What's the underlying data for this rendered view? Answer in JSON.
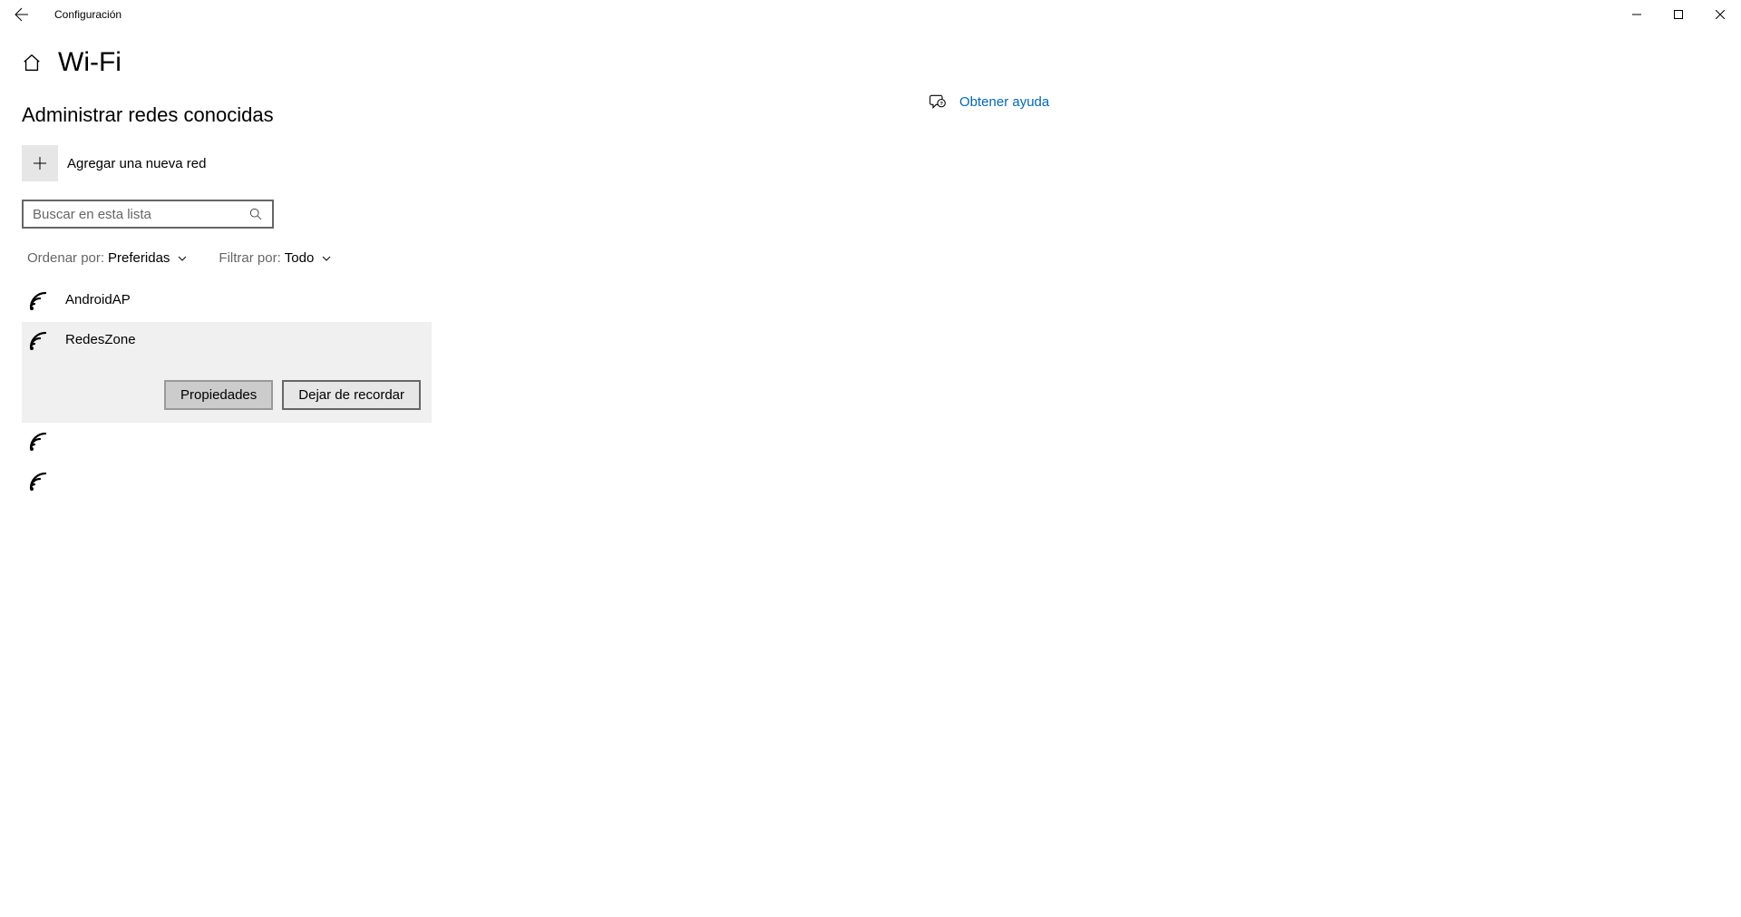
{
  "titlebar": {
    "app_title": "Configuración"
  },
  "page": {
    "title": "Wi-Fi",
    "section_title": "Administrar redes conocidas",
    "add_network_label": "Agregar una nueva red"
  },
  "search": {
    "placeholder": "Buscar en esta lista"
  },
  "sort": {
    "label": "Ordenar por: ",
    "value": "Preferidas"
  },
  "filter": {
    "label": "Filtrar por: ",
    "value": "Todo"
  },
  "networks": [
    {
      "name": "AndroidAP"
    },
    {
      "name": "RedesZone"
    },
    {
      "name": ""
    },
    {
      "name": ""
    }
  ],
  "actions": {
    "properties": "Propiedades",
    "forget": "Dejar de recordar"
  },
  "help": {
    "link_text": "Obtener ayuda"
  }
}
